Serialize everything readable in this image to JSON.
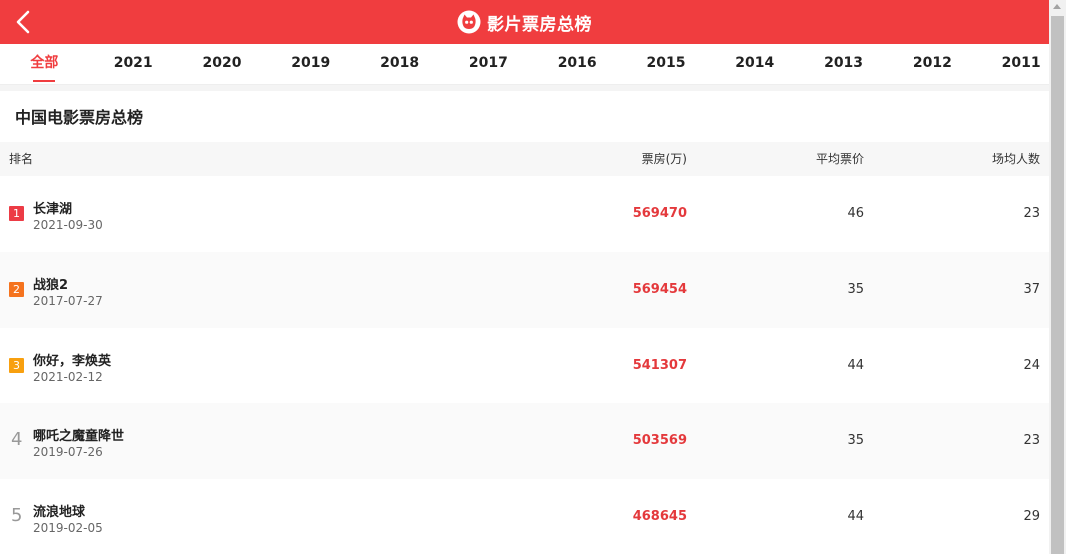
{
  "header": {
    "title": "影片票房总榜"
  },
  "tabs": [
    "全部",
    "2021",
    "2020",
    "2019",
    "2018",
    "2017",
    "2016",
    "2015",
    "2014",
    "2013",
    "2012",
    "2011"
  ],
  "section": {
    "title": "中国电影票房总榜"
  },
  "columns": {
    "rank": "排名",
    "box_office": "票房(万)",
    "avg_price": "平均票价",
    "avg_audience": "场均人数"
  },
  "rows": [
    {
      "rank": "1",
      "name": "长津湖",
      "date": "2021-09-30",
      "box": "569470",
      "avg": "46",
      "aud": "23"
    },
    {
      "rank": "2",
      "name": "战狼2",
      "date": "2017-07-27",
      "box": "569454",
      "avg": "35",
      "aud": "37"
    },
    {
      "rank": "3",
      "name": "你好，李焕英",
      "date": "2021-02-12",
      "box": "541307",
      "avg": "44",
      "aud": "24"
    },
    {
      "rank": "4",
      "name": "哪吒之魔童降世",
      "date": "2019-07-26",
      "box": "503569",
      "avg": "35",
      "aud": "23"
    },
    {
      "rank": "5",
      "name": "流浪地球",
      "date": "2019-02-05",
      "box": "468645",
      "avg": "44",
      "aud": "29"
    }
  ],
  "colors": {
    "brand": "#f03d3f",
    "box_value": "#e4393c",
    "rank1": "#ec3b45",
    "rank2": "#f5731e",
    "rank3": "#f8a00f"
  }
}
